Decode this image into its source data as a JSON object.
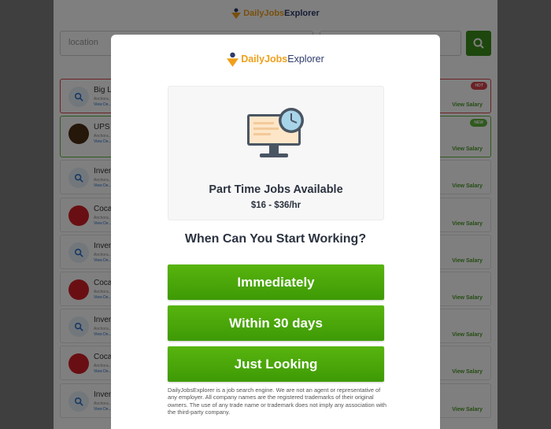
{
  "brand": {
    "name_part1": "DailyJobs",
    "name_part2": "Explorer",
    "accent_orange": "#f0a01a",
    "navy": "#2d3a6b",
    "button_green": "#4caa08"
  },
  "background": {
    "search_placeholder": "location",
    "listings": [
      {
        "icon": "magnifier-icon",
        "title": "Big L...",
        "sub": "Anchora...",
        "link": "View De...",
        "salary": "View Salary",
        "badge": "HOT",
        "state": "hot"
      },
      {
        "icon": "ups-logo-icon",
        "title": "UPS (Hirin...",
        "sub": "Anchora...",
        "link": "View De...",
        "salary": "View Salary",
        "badge": "NEW",
        "state": "new"
      },
      {
        "icon": "magnifier-icon",
        "title": "Inven...",
        "sub": "Anchora...",
        "link": "View De...",
        "salary": "View Salary",
        "badge": "",
        "state": ""
      },
      {
        "icon": "coca-cola-logo-icon",
        "title": "Coca...",
        "sub": "Anchora...",
        "link": "View De...",
        "salary": "View Salary",
        "badge": "",
        "state": ""
      },
      {
        "icon": "magnifier-icon",
        "title": "Inven...",
        "sub": "Anchora...",
        "link": "View De...",
        "salary": "View Salary",
        "badge": "",
        "state": ""
      },
      {
        "icon": "coca-cola-logo-icon",
        "title": "Coca...",
        "sub": "Anchora...",
        "link": "View De...",
        "salary": "View Salary",
        "badge": "",
        "state": ""
      },
      {
        "icon": "magnifier-icon",
        "title": "Inven...",
        "sub": "Anchora...",
        "link": "View De...",
        "salary": "View Salary",
        "badge": "",
        "state": ""
      },
      {
        "icon": "coca-cola-logo-icon",
        "title": "Coca...",
        "sub": "Anchora...",
        "link": "View De...",
        "salary": "View Salary",
        "badge": "",
        "state": ""
      },
      {
        "icon": "magnifier-icon",
        "title": "Inven...",
        "sub": "Anchora...",
        "link": "View De...",
        "salary": "View Salary",
        "badge": "",
        "state": ""
      }
    ]
  },
  "modal": {
    "card": {
      "title": "Part Time Jobs Available",
      "pay": "$16 - $36/hr",
      "illustration": "computer-monitor-clock-icon"
    },
    "question": "When Can You Start Working?",
    "options": [
      "Immediately",
      "Within 30 days",
      "Just Looking"
    ],
    "disclaimer": "DailyJobsExplorer is a job search engine. We are not an agent or representative of any employer. All company names are the registered trademarks of their original owners. The use of any trade name or trademark does not imply any association with the third-party company."
  }
}
